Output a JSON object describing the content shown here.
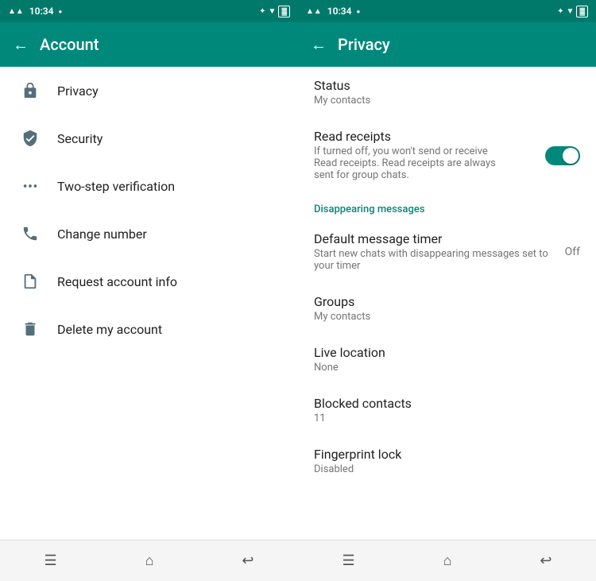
{
  "account_panel": {
    "status_bar": {
      "left": "10:34",
      "dot": "●",
      "right_icons": "⊹ ▲ ▼ ◀ WiFi 🔋"
    },
    "app_bar": {
      "back_label": "←",
      "title": "Account"
    },
    "menu_items": [
      {
        "id": "privacy",
        "label": "Privacy",
        "icon": "lock"
      },
      {
        "id": "security",
        "label": "Security",
        "icon": "shield"
      },
      {
        "id": "two-step",
        "label": "Two-step verification",
        "icon": "dots"
      },
      {
        "id": "change-number",
        "label": "Change number",
        "icon": "phone"
      },
      {
        "id": "request-info",
        "label": "Request account info",
        "icon": "doc"
      },
      {
        "id": "delete",
        "label": "Delete my account",
        "icon": "trash"
      }
    ],
    "bottom_nav": [
      "☰",
      "⌂",
      "↩"
    ]
  },
  "privacy_panel": {
    "status_bar": {
      "left": "10:34",
      "dot": "●"
    },
    "app_bar": {
      "back_label": "←",
      "title": "Privacy"
    },
    "items": [
      {
        "id": "status",
        "title": "Status",
        "subtitle": "My contacts",
        "value": null,
        "toggle": false,
        "section": null
      },
      {
        "id": "read-receipts",
        "title": "Read receipts",
        "subtitle": "If turned off, you won't send or receive Read receipts. Read receipts are always sent for group chats.",
        "value": null,
        "toggle": true,
        "section": null
      },
      {
        "id": "section-disappearing",
        "section_label": "Disappearing messages",
        "title": null
      },
      {
        "id": "default-timer",
        "title": "Default message timer",
        "subtitle": "Start new chats with disappearing messages set to your timer",
        "value": "Off",
        "toggle": false,
        "section": null
      },
      {
        "id": "groups",
        "title": "Groups",
        "subtitle": "My contacts",
        "value": null,
        "toggle": false,
        "section": null
      },
      {
        "id": "live-location",
        "title": "Live location",
        "subtitle": "None",
        "value": null,
        "toggle": false,
        "section": null
      },
      {
        "id": "blocked-contacts",
        "title": "Blocked contacts",
        "subtitle": "11",
        "value": null,
        "toggle": false,
        "section": null
      },
      {
        "id": "fingerprint-lock",
        "title": "Fingerprint lock",
        "subtitle": "Disabled",
        "value": null,
        "toggle": false,
        "section": null
      }
    ],
    "bottom_nav": [
      "☰",
      "⌂",
      "↩"
    ]
  }
}
